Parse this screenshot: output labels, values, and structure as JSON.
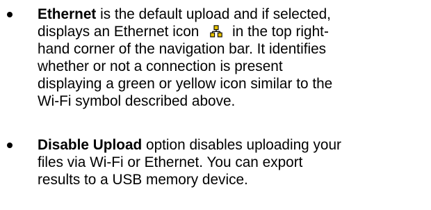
{
  "document": {
    "items": [
      {
        "term": "Ethernet",
        "lines": [
          " is the default upload and if selected,",
          "displays an Ethernet icon",
          " in the top right-",
          "hand corner of the navigation bar. It identifies",
          "whether or not a connection is present",
          "displaying a green or yellow icon similar to the",
          "Wi-Fi symbol described above."
        ]
      },
      {
        "term": "Disable Upload",
        "lines": [
          " option disables uploading your",
          "files via Wi-Fi or Ethernet. You can export",
          "results to a USB memory device."
        ]
      }
    ],
    "icons": {
      "ethernet": "ethernet-icon",
      "ethernet_color": "#e8c300"
    }
  }
}
